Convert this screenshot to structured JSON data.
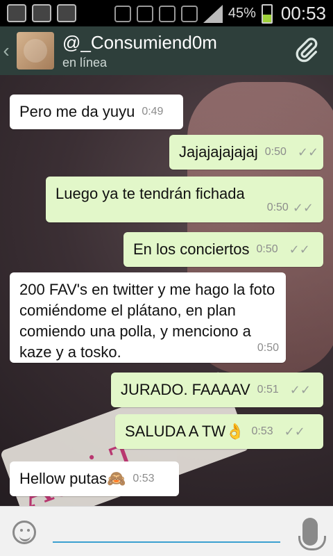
{
  "status_bar": {
    "battery_percent": "45%",
    "time": "00:53",
    "icons": [
      "add-icon",
      "instagram-icon",
      "image-icon",
      "n-icon",
      "vibrate-icon",
      "alarm-icon",
      "wifi-icon",
      "signal-icon",
      "battery-icon"
    ]
  },
  "header": {
    "contact_name": "@_Consumiend0m",
    "status": "en línea",
    "icons": [
      "back-icon",
      "attach-icon"
    ]
  },
  "messages": [
    {
      "dir": "in",
      "text": "Pero me da yuyu",
      "time": "0:49"
    },
    {
      "dir": "out",
      "text": "Jajajajajajaj",
      "time": "0:50"
    },
    {
      "dir": "out",
      "text": "Luego ya te tendrán fichada",
      "time": "0:50"
    },
    {
      "dir": "out",
      "text": "En los conciertos",
      "time": "0:50"
    },
    {
      "dir": "in",
      "text": "200 FAV's en twitter y me hago la foto comiéndome el plátano, en plan comiendo una polla, y menciono a kaze y a tosko.",
      "time": "0:50"
    },
    {
      "dir": "out",
      "text": "JURADO. FAAAAV",
      "time": "0:51"
    },
    {
      "dir": "out",
      "text": "SALUDA A TW👌",
      "time": "0:53"
    },
    {
      "dir": "in",
      "text": "Hellow putas🙈",
      "time": "0:53"
    }
  ],
  "input_bar": {
    "placeholder": "",
    "icons": [
      "emoji-icon",
      "mic-icon"
    ]
  },
  "wallpaper": {
    "text": "Adri-T"
  },
  "colors": {
    "appbar": "#2e3f3b",
    "incoming_bubble": "#ffffff",
    "outgoing_bubble": "#e2f7c9"
  }
}
